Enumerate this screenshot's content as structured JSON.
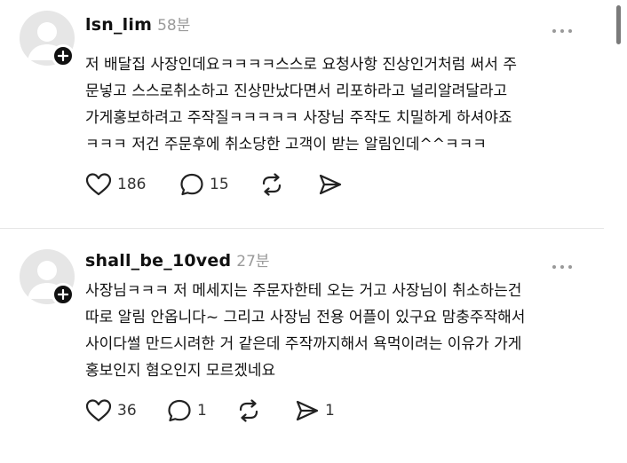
{
  "posts": [
    {
      "username": "lsn_lim",
      "time": "58분",
      "lines": [
        "저 배달집 사장인데요ㅋㅋㅋㅋ스스로 요청사항 진상인거처럼  써서 주",
        "문넣고 스스로취소하고 진상만났다면서 리포하라고 널리알려달라고",
        "가게홍보하려고 주작질ㅋㅋㅋㅋㅋ 사장님  주작도 치밀하게 하셔야죠",
        "ㅋㅋㅋ 저건 주문후에 취소당한 고객이 받는 알림인데^^ㅋㅋㅋ"
      ],
      "likes": "186",
      "comments": "15",
      "reposts": "",
      "shares": ""
    },
    {
      "username": "shall_be_10ved",
      "time": "27분",
      "lines": [
        "사장님ㅋㅋㅋ 저 메세지는 주문자한테 오는 거고 사장님이 취소하는건",
        "따로 알림 안옵니다~ 그리고 사장님 전용 어플이 있구요 맘충주작해서",
        "사이다썰 만드시려한 거 같은데 주작까지해서 욕먹이려는 이유가 가게",
        "홍보인지 혐오인지 모르겠네요"
      ],
      "likes": "36",
      "comments": "1",
      "reposts": "",
      "shares": "1"
    }
  ],
  "icons": {
    "like": "heart-icon",
    "comment": "speech-bubble-icon",
    "repost": "repost-arrows-icon",
    "share": "send-icon",
    "more": "more-dots-icon",
    "follow": "plus-icon"
  },
  "colors": {
    "text": "#111111",
    "muted": "#9a9a9a",
    "avatar_bg": "#e6e6e6",
    "divider": "#e6e6e6"
  }
}
